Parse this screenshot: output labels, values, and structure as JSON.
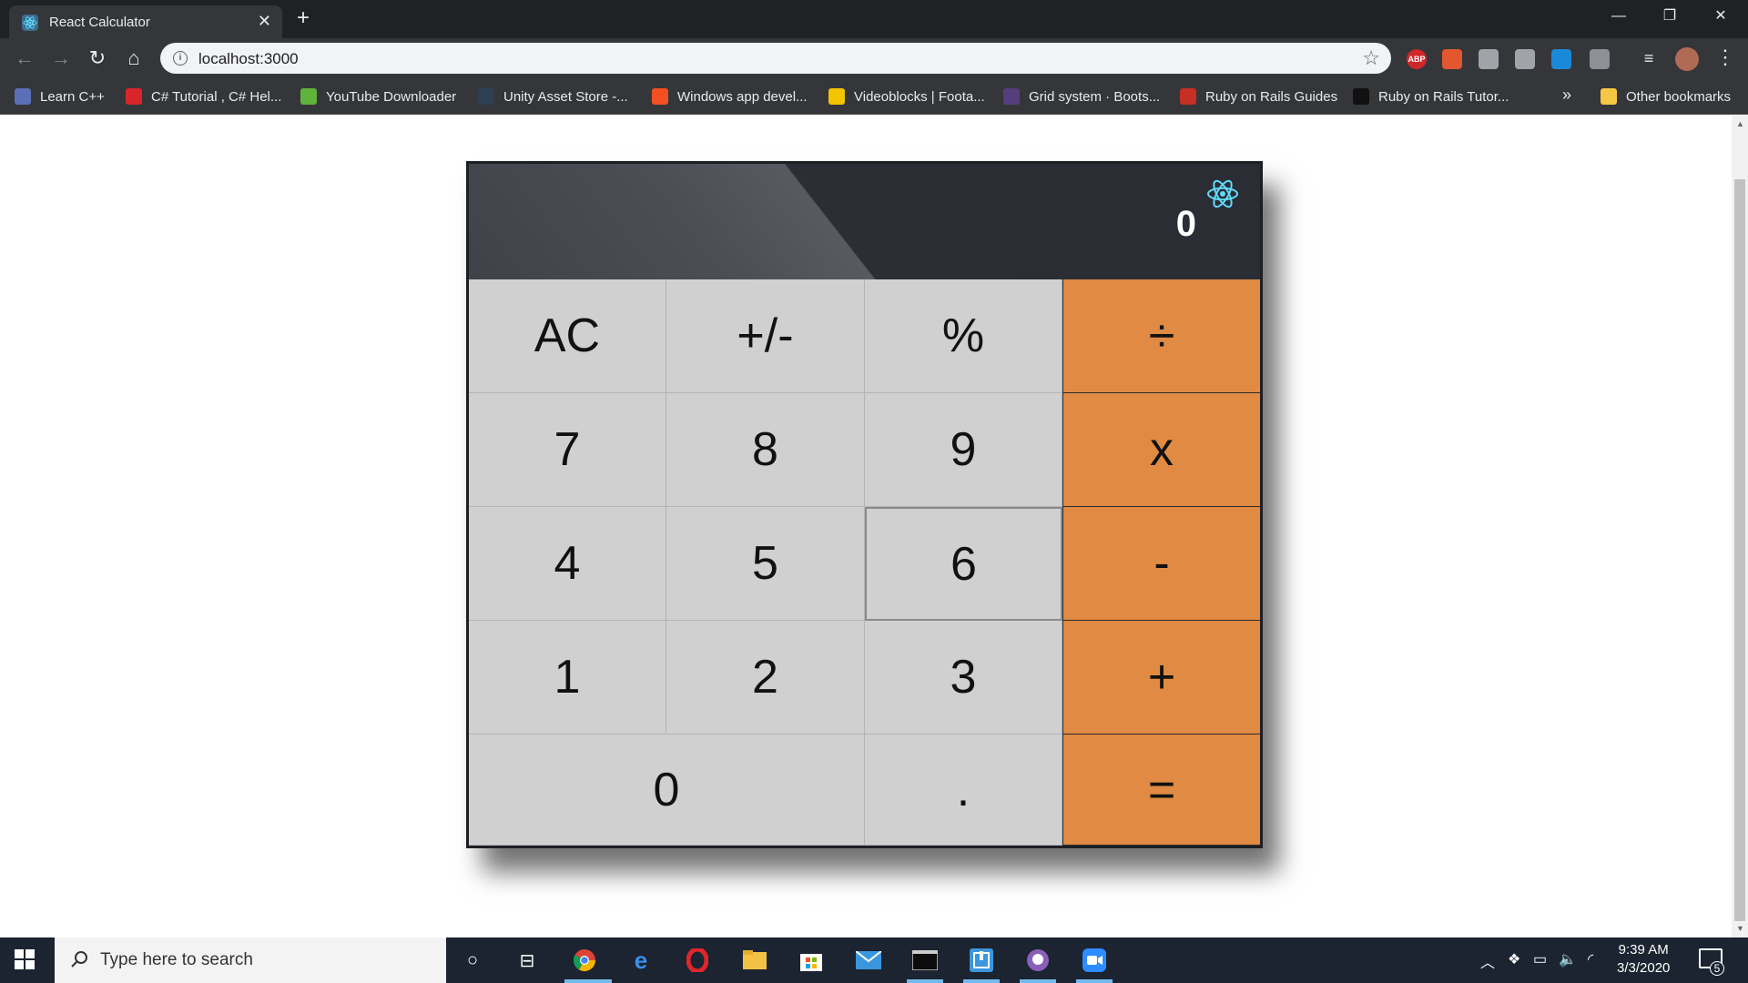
{
  "browser": {
    "tab_title": "React Calculator",
    "tab_close": "✕",
    "new_tab": "+",
    "url": "localhost:3000",
    "window_controls": [
      "—",
      "❐",
      "✕"
    ],
    "extensions": [
      {
        "name": "adblock-plus-icon",
        "label": "ABP",
        "color": "#d0272a"
      },
      {
        "name": "office-icon",
        "label": "",
        "color": "#e2572f"
      },
      {
        "name": "extension-icon",
        "label": "",
        "color": "#a0a3a7"
      },
      {
        "name": "shield-icon",
        "label": "",
        "color": "#a0a3a7"
      },
      {
        "name": "c-icon",
        "label": "",
        "color": "#1a8ad8"
      },
      {
        "name": "mouse-icon",
        "label": "",
        "color": "#8d9096"
      }
    ]
  },
  "bookmarks": [
    {
      "label": "Learn C++",
      "icon": "cpp-icon",
      "color": "#5a6fb8"
    },
    {
      "label": "C# Tutorial , C# Hel...",
      "icon": "n-icon",
      "color": "#d9252a"
    },
    {
      "label": "YouTube Downloader",
      "icon": "download-arrow-icon",
      "color": "#5fb33a"
    },
    {
      "label": "Unity Asset Store -...",
      "icon": "unity-icon",
      "color": "#2d3f52"
    },
    {
      "label": "Windows app devel...",
      "icon": "windows-logo-icon",
      "color": "#f25022"
    },
    {
      "label": "Videoblocks | Foota...",
      "icon": "dollar-icon",
      "color": "#f5c400"
    },
    {
      "label": "Grid system · Boots...",
      "icon": "bootstrap-icon",
      "color": "#563d7c"
    },
    {
      "label": "Ruby on Rails Guides",
      "icon": "rails-icon",
      "color": "#c52f24"
    },
    {
      "label": "Ruby on Rails Tutor...",
      "icon": "tutorial-icon",
      "color": "#111111"
    }
  ],
  "bookmarks_more": "»",
  "other_bookmarks": "Other bookmarks",
  "calculator": {
    "display": "0",
    "keys": [
      {
        "label": "AC",
        "type": "fn",
        "name": "all-clear-button"
      },
      {
        "label": "+/-",
        "type": "fn",
        "name": "sign-toggle-button"
      },
      {
        "label": "%",
        "type": "fn",
        "name": "percent-button"
      },
      {
        "label": "÷",
        "type": "op",
        "name": "divide-button"
      },
      {
        "label": "7",
        "type": "num",
        "name": "digit-7-button"
      },
      {
        "label": "8",
        "type": "num",
        "name": "digit-8-button"
      },
      {
        "label": "9",
        "type": "num",
        "name": "digit-9-button"
      },
      {
        "label": "x",
        "type": "op",
        "name": "multiply-button"
      },
      {
        "label": "4",
        "type": "num",
        "name": "digit-4-button"
      },
      {
        "label": "5",
        "type": "num",
        "name": "digit-5-button"
      },
      {
        "label": "6",
        "type": "num",
        "name": "digit-6-button"
      },
      {
        "label": "-",
        "type": "op",
        "name": "subtract-button"
      },
      {
        "label": "1",
        "type": "num",
        "name": "digit-1-button"
      },
      {
        "label": "2",
        "type": "num",
        "name": "digit-2-button"
      },
      {
        "label": "3",
        "type": "num",
        "name": "digit-3-button"
      },
      {
        "label": "+",
        "type": "op",
        "name": "add-button"
      },
      {
        "label": "0",
        "type": "num",
        "name": "digit-0-button"
      },
      {
        "label": ".",
        "type": "num",
        "name": "decimal-button"
      },
      {
        "label": "=",
        "type": "op",
        "name": "equals-button"
      }
    ],
    "colors": {
      "operator": "#e08a43",
      "key": "#d0d0d0",
      "display_bg": "#2a2d34",
      "react_logo": "#61dafb"
    }
  },
  "taskbar": {
    "search_placeholder": "Type here to search",
    "time": "9:39 AM",
    "date": "3/3/2020",
    "notification_count": "5"
  }
}
